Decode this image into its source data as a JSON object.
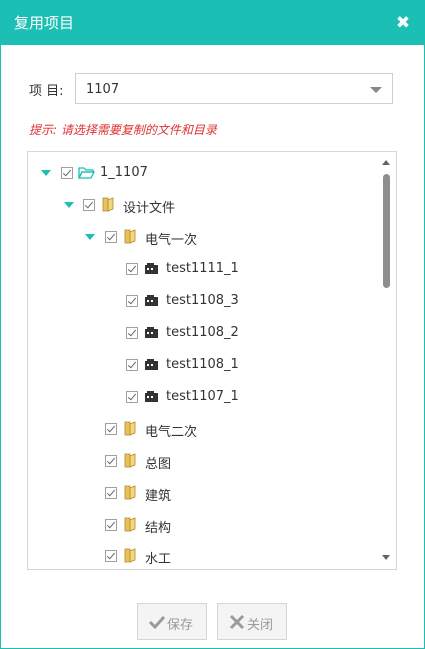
{
  "dialog": {
    "title": "复用项目",
    "close_icon": "close-icon"
  },
  "project": {
    "label": "项  目:",
    "selected": "1107"
  },
  "tip": "提示: 请选择需要复制的文件和目录",
  "tree": {
    "items": [
      {
        "label": "1_1107",
        "type": "folder-open",
        "expanded": true,
        "checked": true
      },
      {
        "label": "设计文件",
        "type": "folder",
        "expanded": true,
        "checked": true
      },
      {
        "label": "电气一次",
        "type": "folder",
        "expanded": true,
        "checked": true
      },
      {
        "label": "test1111_1",
        "type": "file",
        "checked": true
      },
      {
        "label": "test1108_3",
        "type": "file",
        "checked": true
      },
      {
        "label": "test1108_2",
        "type": "file",
        "checked": true
      },
      {
        "label": "test1108_1",
        "type": "file",
        "checked": true
      },
      {
        "label": "test1107_1",
        "type": "file",
        "checked": true
      },
      {
        "label": "电气二次",
        "type": "folder",
        "checked": true
      },
      {
        "label": "总图",
        "type": "folder",
        "checked": true
      },
      {
        "label": "建筑",
        "type": "folder",
        "checked": true
      },
      {
        "label": "结构",
        "type": "folder",
        "checked": true
      },
      {
        "label": "水工",
        "type": "folder",
        "checked": true
      }
    ]
  },
  "buttons": {
    "save": "保存",
    "close": "关闭"
  },
  "colors": {
    "accent": "#1bbfb4",
    "tip": "#e03030"
  }
}
